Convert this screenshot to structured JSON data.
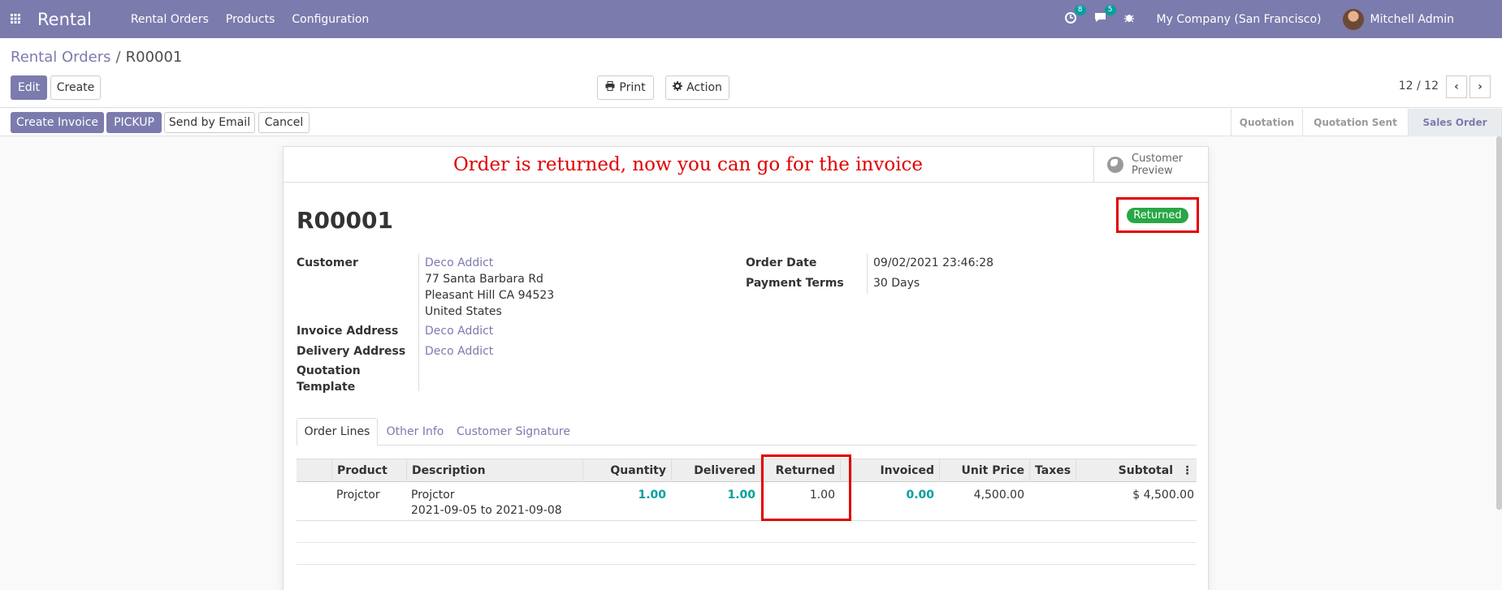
{
  "navbar": {
    "app_name": "Rental",
    "menu": [
      "Rental Orders",
      "Products",
      "Configuration"
    ],
    "activity_count": "8",
    "message_count": "5",
    "company": "My Company (San Francisco)",
    "user": "Mitchell Admin"
  },
  "breadcrumb": {
    "parent": "Rental Orders",
    "current": "R00001"
  },
  "control": {
    "edit": "Edit",
    "create": "Create",
    "print": "Print",
    "action": "Action",
    "pager": "12 / 12"
  },
  "statusbar": {
    "buttons": [
      "Create Invoice",
      "PICKUP",
      "Send by Email",
      "Cancel"
    ],
    "stages": [
      "Quotation",
      "Quotation Sent",
      "Sales Order"
    ],
    "active_stage": "Sales Order"
  },
  "sheet": {
    "banner": "Order is returned, now you can go for the invoice",
    "preview_line1": "Customer",
    "preview_line2": "Preview",
    "status": "Returned",
    "status_color": "#28a745",
    "order_name": "R00001"
  },
  "fields": {
    "customer_label": "Customer",
    "customer_name": "Deco Addict",
    "address_line1": "77 Santa Barbara Rd",
    "address_line2": "Pleasant Hill CA 94523",
    "address_line3": "United States",
    "invoice_address_label": "Invoice Address",
    "invoice_address": "Deco Addict",
    "delivery_address_label": "Delivery Address",
    "delivery_address": "Deco Addict",
    "template_label_1": "Quotation",
    "template_label_2": "Template",
    "order_date_label": "Order Date",
    "order_date": "09/02/2021 23:46:28",
    "payment_terms_label": "Payment Terms",
    "payment_terms": "30 Days"
  },
  "tabs": [
    "Order Lines",
    "Other Info",
    "Customer Signature"
  ],
  "table": {
    "columns": [
      "Product",
      "Description",
      "Quantity",
      "Delivered",
      "Returned",
      "Invoiced",
      "Unit Price",
      "Taxes",
      "Subtotal"
    ],
    "rows": [
      {
        "product": "Projctor",
        "description_1": "Projctor",
        "description_2": "2021-09-05 to 2021-09-08",
        "quantity": "1.00",
        "delivered": "1.00",
        "returned": "1.00",
        "invoiced": "0.00",
        "unit_price": "4,500.00",
        "taxes": "",
        "subtotal": "$ 4,500.00"
      }
    ]
  },
  "colors": {
    "brand": "#7c7bad",
    "teal": "#01a09d",
    "highlight": "#e00000"
  }
}
